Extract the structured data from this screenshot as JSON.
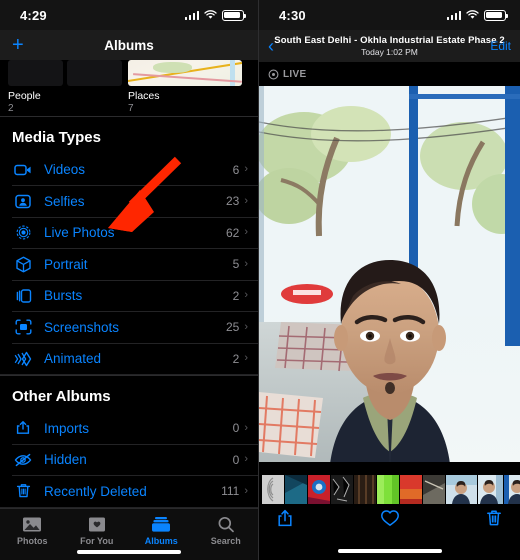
{
  "left": {
    "status": {
      "time": "4:29",
      "signal_icon": "cellular-signal-icon",
      "wifi_icon": "wifi-icon",
      "battery_icon": "battery-icon"
    },
    "navbar": {
      "add_label": "+",
      "title": "Albums"
    },
    "top_albums": [
      {
        "name": "People",
        "count": "2",
        "thumb": "people-thumb"
      },
      {
        "name": "Places",
        "count": "7",
        "thumb": "map-thumb"
      }
    ],
    "sections": [
      {
        "header": "Media Types",
        "rows": [
          {
            "label": "Videos",
            "count": "6",
            "icon": "video-camera-icon"
          },
          {
            "label": "Selfies",
            "count": "23",
            "icon": "selfie-person-icon"
          },
          {
            "label": "Live Photos",
            "count": "62",
            "icon": "live-photo-icon"
          },
          {
            "label": "Portrait",
            "count": "5",
            "icon": "cube-icon"
          },
          {
            "label": "Bursts",
            "count": "2",
            "icon": "burst-stack-icon"
          },
          {
            "label": "Screenshots",
            "count": "25",
            "icon": "screenshot-frame-icon"
          },
          {
            "label": "Animated",
            "count": "2",
            "icon": "animated-chevrons-icon"
          }
        ]
      },
      {
        "header": "Other Albums",
        "rows": [
          {
            "label": "Imports",
            "count": "0",
            "icon": "import-tray-icon"
          },
          {
            "label": "Hidden",
            "count": "0",
            "icon": "eye-slash-icon"
          },
          {
            "label": "Recently Deleted",
            "count": "111",
            "icon": "trash-icon"
          }
        ]
      }
    ],
    "chevron": "›",
    "tabs": [
      {
        "label": "Photos",
        "icon": "photos-icon",
        "active": false
      },
      {
        "label": "For You",
        "icon": "for-you-icon",
        "active": false
      },
      {
        "label": "Albums",
        "icon": "albums-icon",
        "active": true
      },
      {
        "label": "Search",
        "icon": "search-icon",
        "active": false
      }
    ],
    "annotation": {
      "type": "red-arrow",
      "color": "#FF2600",
      "points_to": "Live Photos"
    }
  },
  "right": {
    "status": {
      "time": "4:30",
      "signal_icon": "cellular-signal-icon",
      "wifi_icon": "wifi-icon",
      "battery_icon": "battery-icon"
    },
    "navbar": {
      "back_icon": "chevron-left-icon",
      "title": "South East Delhi - Okhla Industrial Estate Phase 2",
      "subtitle": "Today  1:02 PM",
      "edit_label": "Edit"
    },
    "live_badge": {
      "label": "LIVE",
      "icon": "live-photo-icon"
    },
    "photo": {
      "description": "selfie-photo"
    },
    "toolbar": [
      {
        "icon": "share-icon",
        "name": "share-button"
      },
      {
        "icon": "heart-icon",
        "name": "favorite-button"
      },
      {
        "icon": "trash-icon",
        "name": "delete-button"
      }
    ]
  },
  "colors": {
    "accent": "#0A84FF",
    "annotation": "#FF2600",
    "secondary_text": "#8E8E93"
  }
}
